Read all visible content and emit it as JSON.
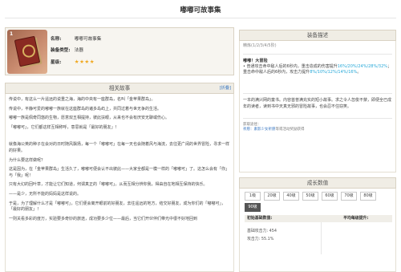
{
  "page": {
    "title": "嘟嘟可故事集"
  },
  "item": {
    "level": "1",
    "name_label": "名称:",
    "name_value": "嘟嘟可故事集",
    "type_label": "装备类型:",
    "type_value": "法器",
    "rarity_label": "星级:",
    "stars": "★★★★"
  },
  "story": {
    "header": "相关故事",
    "toggle": "[折叠]",
    "paragraphs": [
      "传说中，有这么一片遥远的说重之海，海的中央有一座群岛，名叫「金苹果群岛」。",
      "传说中，平静可爱的嘟嘟一族就在这座群岛的诸多岛屿上，共同过着与世无争的生活。",
      "嘟嘟一族是佩奇同悠的生物，愿意双五相提持，彼此扶眼，从来也不会有厌安无聊或伤心。",
      "「嘟嘟可」，它们都这样互相称呼，意思就是「最好的朋友」！",
      "就像海公英的种子在会对的日时随风飘扬，每一个「嘟嘟可」在每一天也会随着风与海流，去往更广阔的世界冒险，寻求一样的好果。",
      "为什么要这样做呢？",
      "这是因为，在「金苹果群岛」生活久了，嘟嘟可便会认不出彼此——大家全都是一模一样的「嘟嘟可」了。这怎么会有「你」与「我」呢！",
      "只有大幻的回叶草，才能让它们知道，何谓真正的「嘟嘟可」。从而互相分辨你我，得由自在地相互保持的快乐。",
      "——是少，无所不能的妈妈是这样说的。",
      "于是，为了理解什么才是「嘟嘟可」，它们便会离开眼前的好朋友，去往遥远的地方，结交好朋友，成为你们的「嘟嘟可」，「最好的朋友」！",
      "一则关看多彩的度万，实验要多奇妙的旅途，成功要多少位——最后，当它们开伙伴们带光中很不好地回到"
    ]
  },
  "desc": {
    "header": "装备描述",
    "refine_line": "精炼(1/2/3/4/5阶)",
    "skill_name": "嘟嘟！大冒险",
    "effect_prefix": "• 普通攻击命中敌人后的6秒内，重击造成的伤害提升",
    "effect_values_1": "16%/20%/24%/28%/32%",
    "effect_mid": "；重击命中敌人后的6秒内，攻击力提升",
    "effect_values_2": "8%/10%/12%/14%/16%",
    "effect_suffix": "。",
    "flavor": "一本的满兴网的童书。内容首普满充实的短小故事。求之令人忽俊不禁，即便全已成年的读者，读到书中天真无邪的冒险故事，也会忍不住窃笑。",
    "source_label": "获取途径：",
    "source_link": "祈愿：素影少女祈愿",
    "source_suffix": "等或活动奖励获得"
  },
  "growth": {
    "header": "成长数值",
    "levels": [
      "1级",
      "20级",
      "40级",
      "50级",
      "60级",
      "70级",
      "80级",
      "90级"
    ],
    "active_level": "90级",
    "col_initial": "初始基础数值:",
    "col_growth": "平均每级提升:",
    "stat_atk": "基础攻击力: 454",
    "stat_sub": "攻击力: 55.1%"
  },
  "colors": {
    "highlight": "#27a8d8",
    "link": "#3a78c2",
    "star": "#f0a81f",
    "border": "#d9d2c3",
    "active_button": "#555555"
  }
}
